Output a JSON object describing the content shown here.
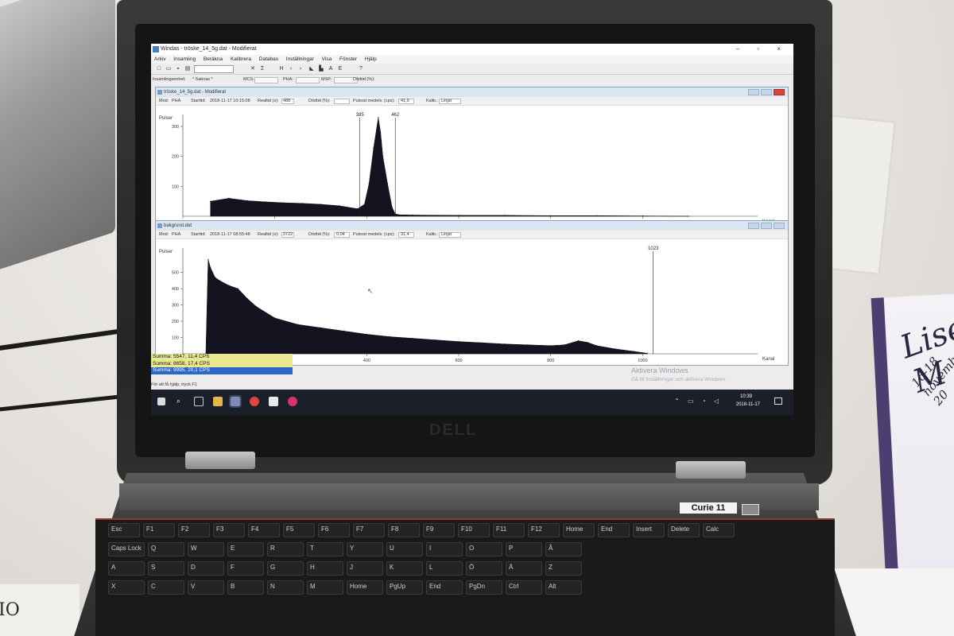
{
  "background": {
    "book_script": "Lise M",
    "book_subtitle": "16-18 november 20",
    "bottom_left_text": "IO"
  },
  "laptop": {
    "brand": "DELL",
    "label": "Curie 11"
  },
  "keys": [
    "Esc",
    "F1",
    "F2",
    "F3",
    "F4",
    "F5",
    "F6",
    "F7",
    "F8",
    "F9",
    "F10",
    "F11",
    "F12",
    "Home",
    "End",
    "Insert",
    "Delete",
    "Calc",
    "Caps Lock",
    "Q",
    "W",
    "E",
    "R",
    "T",
    "Y",
    "U",
    "I",
    "O",
    "P",
    "Å",
    "A",
    "S",
    "D",
    "F",
    "G",
    "H",
    "J",
    "K",
    "L",
    "Ö",
    "Ä",
    "Z",
    "X",
    "C",
    "V",
    "B",
    "N",
    "M",
    "Home",
    "PgUp",
    "End",
    "PgDn",
    "Ctrl",
    "Alt"
  ],
  "window": {
    "title": "Windas - tröske_14_5g.dat - Modifierat",
    "controls": "– ▫ ×"
  },
  "menu": [
    "Arkiv",
    "Insamling",
    "Beräkna",
    "Kalibrera",
    "Databas",
    "Inställningar",
    "Visa",
    "Fönster",
    "Hjälp"
  ],
  "infobar": {
    "device_label": "Insamlingsenhet:",
    "device_value": "* Saknas *",
    "mcs": "MCS:",
    "pha": "PHA:",
    "msp": "MSP:",
    "deadtime": "Dödtid (%):"
  },
  "child1": {
    "title": "tröske_14_5g.dat - Modifierat",
    "mode_label": "Mod:",
    "mode_value": "PHA",
    "start_label": "Starttid:",
    "start_value": "2018-11-17   10:15:08",
    "real_label": "Realtid (s):",
    "real_value": "488",
    "dead_label": "Dödtid (%):",
    "rate_label": "Pulsrat medelv. (cps):",
    "rate_value": "41,9",
    "calib_label": "Kalib.:",
    "calib_value": "Linjär"
  },
  "child2": {
    "title": "bakgrund.dat",
    "mode_label": "Mod:",
    "mode_value": "PHA",
    "start_label": "Starttid:",
    "start_value": "2018-11-17   08:55:48",
    "real_label": "Realtid (s):",
    "real_value": "3722",
    "dead_label": "Dödtid (%):",
    "dead_value": "0,04",
    "rate_label": "Pulsrat medelv. (cps):",
    "rate_value": "31,4",
    "calib_label": "Kalib.:",
    "calib_value": "Linjär"
  },
  "chart_data": [
    {
      "type": "area",
      "ylabel": "Pulser",
      "xlabel": "Kanal",
      "xlim": [
        0,
        1250
      ],
      "ylim": [
        0,
        340
      ],
      "x_ticks": [
        0,
        200,
        400,
        600,
        800,
        1000
      ],
      "y_ticks": [
        100,
        200,
        300
      ],
      "markers": [
        {
          "label": "385",
          "x": 385
        },
        {
          "label": "462",
          "x": 462
        }
      ],
      "x": [
        60,
        100,
        140,
        180,
        220,
        260,
        300,
        340,
        380,
        395,
        405,
        415,
        425,
        430,
        435,
        445,
        455,
        462,
        470,
        500,
        600,
        700,
        800,
        900,
        1000,
        1100
      ],
      "y": [
        50,
        60,
        52,
        48,
        45,
        43,
        40,
        35,
        25,
        40,
        110,
        230,
        330,
        280,
        200,
        110,
        30,
        8,
        5,
        4,
        3,
        3,
        2,
        2,
        1,
        0
      ]
    },
    {
      "type": "area",
      "ylabel": "Pulser",
      "xlabel": "Kanal",
      "xlim": [
        0,
        1250
      ],
      "ylim": [
        0,
        650
      ],
      "x_ticks": [
        0,
        200,
        400,
        600,
        800,
        1000
      ],
      "y_ticks": [
        100,
        200,
        300,
        400,
        500
      ],
      "markers": [
        {
          "label": "1023",
          "x": 1023
        }
      ],
      "x": [
        50,
        55,
        60,
        70,
        80,
        100,
        120,
        140,
        160,
        200,
        250,
        300,
        350,
        400,
        450,
        500,
        550,
        600,
        650,
        700,
        750,
        800,
        830,
        860,
        880,
        900,
        940,
        980,
        1010
      ],
      "y": [
        0,
        580,
        530,
        470,
        450,
        420,
        400,
        340,
        290,
        220,
        180,
        160,
        140,
        120,
        105,
        95,
        85,
        75,
        68,
        60,
        55,
        50,
        55,
        80,
        70,
        50,
        30,
        15,
        3
      ]
    }
  ],
  "summary": [
    "Summa: 5547,  11,4 CPS",
    "Summa: 8658,  17,4 CPS",
    "Summa: 9995,  20,1 CPS"
  ],
  "help": "För att få hjälp, tryck F1",
  "activate": {
    "title": "Aktivera Windows",
    "subtitle": "Gå till Inställningar och aktivera Windows"
  },
  "clock": {
    "time": "10:39",
    "date": "2018-11-17"
  }
}
